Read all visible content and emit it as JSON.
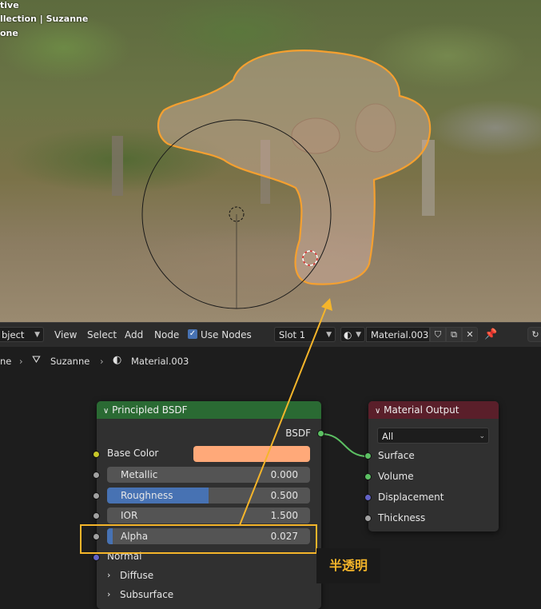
{
  "viewport": {
    "info_lines": [
      "tive",
      "llection | Suzanne",
      "one"
    ]
  },
  "header": {
    "mode_label": "bject",
    "menu_view": "View",
    "menu_select": "Select",
    "menu_add": "Add",
    "menu_node": "Node",
    "use_nodes_label": "Use Nodes",
    "use_nodes_checked": true,
    "slot_label": "Slot 1",
    "material_name": "Material.003"
  },
  "breadcrumb": {
    "part0": "ne",
    "object": "Suzanne",
    "material": "Material.003"
  },
  "bsdf_node": {
    "title": "Principled BSDF",
    "output_label": "BSDF",
    "base_color_label": "Base Color",
    "base_color": "#ffa979",
    "metallic_label": "Metallic",
    "metallic_value": "0.000",
    "roughness_label": "Roughness",
    "roughness_value": "0.500",
    "roughness_fraction": 0.5,
    "ior_label": "IOR",
    "ior_value": "1.500",
    "alpha_label": "Alpha",
    "alpha_value": "0.027",
    "alpha_fraction": 0.027,
    "normal_label": "Normal",
    "diffuse_label": "Diffuse",
    "subsurface_label": "Subsurface"
  },
  "output_node": {
    "title": "Material Output",
    "target": "All",
    "surface_label": "Surface",
    "volume_label": "Volume",
    "displacement_label": "Displacement",
    "thickness_label": "Thickness"
  },
  "annotation": {
    "label": "半透明",
    "color": "#f5b52a"
  },
  "colors": {
    "bsdf_header": "#2a6a33",
    "output_header": "#5a1f2a",
    "socket_shader": "#5cc063",
    "socket_color": "#c7c729",
    "socket_float": "#a1a1a1",
    "socket_vector": "#6363c7",
    "accent": "#4772b3",
    "selection": "#f5a030"
  }
}
